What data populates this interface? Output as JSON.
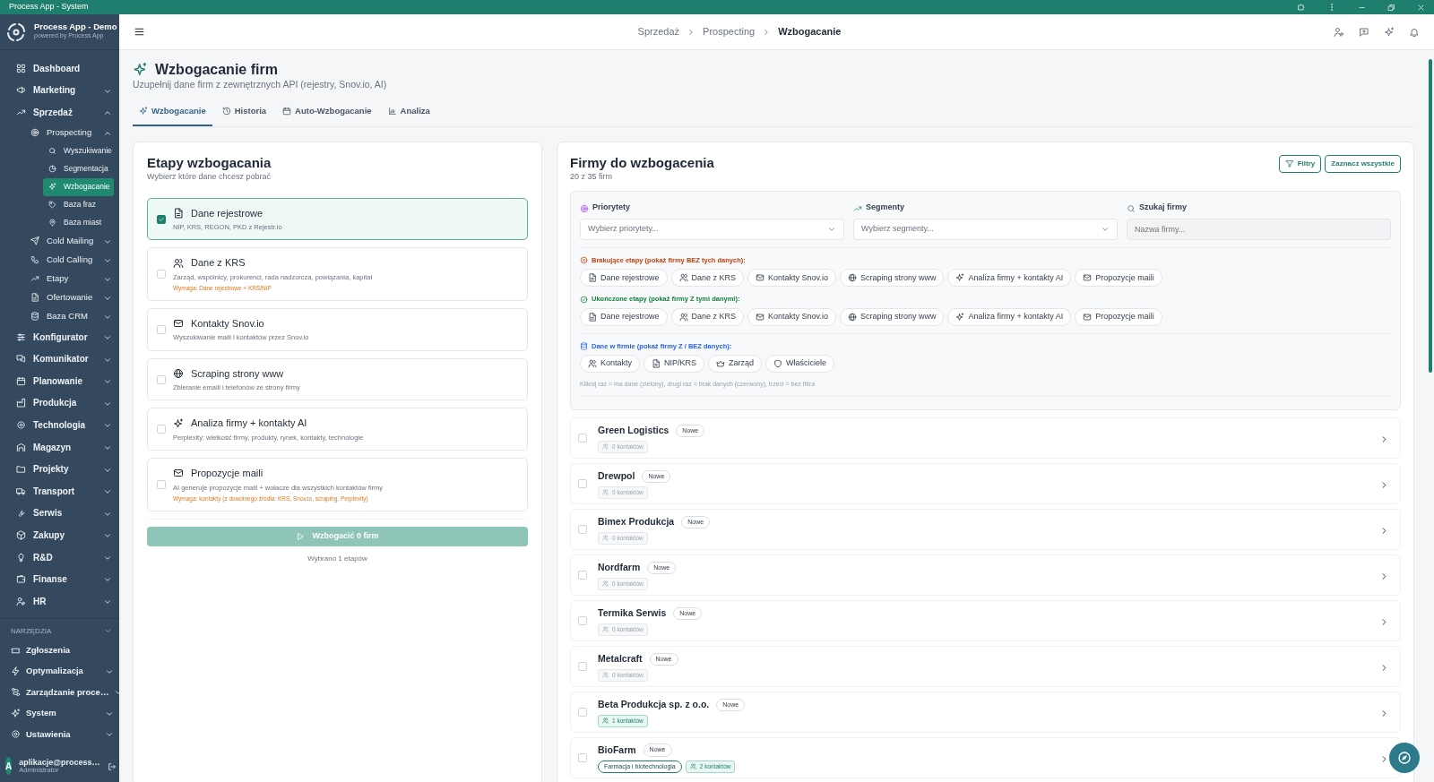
{
  "window": {
    "title": "Process App - System"
  },
  "sidebar": {
    "app_title": "Process App - Demo",
    "app_subtitle": "powered by Process App",
    "items": [
      {
        "label": "Dashboard",
        "selected": false
      },
      {
        "label": "Marketing",
        "selected": false,
        "expanded": false
      },
      {
        "label": "Sprzedaż",
        "selected": false,
        "expanded": true,
        "children": [
          {
            "label": "Prospecting",
            "selected": false,
            "expanded": true,
            "children": [
              {
                "label": "Wyszukiwanie",
                "selected": false
              },
              {
                "label": "Segmentacja",
                "selected": false
              },
              {
                "label": "Wzbogacanie",
                "selected": true
              },
              {
                "label": "Baza fraz",
                "selected": false
              },
              {
                "label": "Baza miast",
                "selected": false
              }
            ]
          },
          {
            "label": "Cold Mailing",
            "selected": false,
            "expanded": false
          },
          {
            "label": "Cold Calling",
            "selected": false,
            "expanded": false
          },
          {
            "label": "Etapy",
            "selected": false,
            "expanded": false
          },
          {
            "label": "Ofertowanie",
            "selected": false,
            "expanded": false
          },
          {
            "label": "Baza CRM",
            "selected": false,
            "expanded": false
          }
        ]
      },
      {
        "label": "Konfigurator",
        "selected": false,
        "expanded": false
      },
      {
        "label": "Komunikator",
        "selected": false,
        "expanded": false
      },
      {
        "label": "Planowanie",
        "selected": false,
        "expanded": false
      },
      {
        "label": "Produkcja",
        "selected": false,
        "expanded": false
      },
      {
        "label": "Technologia",
        "selected": false,
        "expanded": false
      },
      {
        "label": "Magazyn",
        "selected": false,
        "expanded": false
      },
      {
        "label": "Projekty",
        "selected": false,
        "expanded": false
      },
      {
        "label": "Transport",
        "selected": false,
        "expanded": false
      },
      {
        "label": "Serwis",
        "selected": false,
        "expanded": false
      },
      {
        "label": "Zakupy",
        "selected": false,
        "expanded": false
      },
      {
        "label": "R&D",
        "selected": false,
        "expanded": false
      },
      {
        "label": "Finanse",
        "selected": false,
        "expanded": false
      },
      {
        "label": "HR",
        "selected": false,
        "expanded": false
      }
    ],
    "section": "NARZĘDZIA",
    "tools": [
      {
        "label": "Zgłoszenia",
        "selected": false
      },
      {
        "label": "Optymalizacja",
        "selected": false,
        "expanded": false
      },
      {
        "label": "Zarządzanie proce…",
        "selected": false,
        "expanded": false
      },
      {
        "label": "System",
        "selected": false,
        "expanded": false
      },
      {
        "label": "Ustawienia",
        "selected": false,
        "expanded": false
      }
    ],
    "user": {
      "avatar": "A",
      "name": "aplikacje@process…",
      "role": "Administrator"
    }
  },
  "breadcrumbs": [
    "Sprzedaż",
    "Prospecting",
    "Wzbogacanie"
  ],
  "page": {
    "title": "Wzbogacanie firm",
    "subtitle": "Uzupełnij dane firm z zewnętrznych API (rejestry, Snov.io, AI)"
  },
  "tabs": [
    {
      "label": "Wzbogacanie",
      "selected": true
    },
    {
      "label": "Historia",
      "selected": false
    },
    {
      "label": "Auto-Wzbogacanie",
      "selected": false
    },
    {
      "label": "Analiza",
      "selected": false
    }
  ],
  "stages_card": {
    "title": "Etapy wzbogacania",
    "subtitle": "Wybierz które dane chcesz pobrać",
    "stages": [
      {
        "title": "Dane rejestrowe",
        "description": "NIP, KRS, REGON, PKD z Rejestr.io",
        "checked": true
      },
      {
        "title": "Dane z KRS",
        "description": "Zarząd, wspólnicy, prokurenci, rada nadzorcza, powiązania, kapitał",
        "requirement": "Wymaga: Dane rejestrowe + KRS/NIP",
        "checked": false
      },
      {
        "title": "Kontakty Snov.io",
        "description": "Wyszukiwanie maili i kontaktów przez Snov.io",
        "checked": false
      },
      {
        "title": "Scraping strony www",
        "description": "Zbieranie emaili i telefonów ze strony firmy",
        "checked": false
      },
      {
        "title": "Analiza firmy + kontakty AI",
        "description": "Perplexity: wielkość firmy, produkty, rynek, kontakty, technologie",
        "checked": false
      },
      {
        "title": "Propozycje maili",
        "description": "AI generuje propozycje maili + wołacze dla wszystkich kontaktów firmy",
        "requirement": "Wymaga: kontakty (z dowolnego źródła: KRS, Snov.io, scraping, Perplexity)",
        "checked": false
      }
    ],
    "button": {
      "label": "Wzbogacić 0 firm",
      "disabled": true
    },
    "footnote": "Wybrano 1 etapów"
  },
  "companies_card": {
    "title": "Firmy do wzbogacenia",
    "count": "20 z 35 firm",
    "buttons": [
      "Filtry",
      "Zaznacz wszystkie"
    ],
    "filters": {
      "priority": {
        "label": "Priorytety",
        "placeholder": "Wybierz priorytety..."
      },
      "segments": {
        "label": "Segmenty",
        "placeholder": "Wybierz segmenty..."
      },
      "search": {
        "label": "Szukaj firmy",
        "placeholder": "Nazwa firmy..."
      },
      "missing": {
        "label": "Brakujące etapy (pokaż firmy BEZ tych danych):",
        "chips": [
          {
            "label": "Dane rejestrowe",
            "selected": false
          },
          {
            "label": "Dane z KRS",
            "selected": false
          },
          {
            "label": "Kontakty Snov.io",
            "selected": false
          },
          {
            "label": "Scraping strony www",
            "selected": false
          },
          {
            "label": "Analiza firmy + kontakty AI",
            "selected": false
          },
          {
            "label": "Propozycje maili",
            "selected": false
          }
        ]
      },
      "completed": {
        "label": "Ukończone etapy (pokaż firmy Z tymi danymi):",
        "chips": [
          {
            "label": "Dane rejestrowe",
            "selected": false
          },
          {
            "label": "Dane z KRS",
            "selected": false
          },
          {
            "label": "Kontakty Snov.io",
            "selected": false
          },
          {
            "label": "Scraping strony www",
            "selected": false
          },
          {
            "label": "Analiza firmy + kontakty AI",
            "selected": false
          },
          {
            "label": "Propozycje maili",
            "selected": false
          }
        ]
      },
      "company_data": {
        "label": "Dane w firmie (pokaż firmy Z / BEZ danych):",
        "chips": [
          {
            "label": "Kontakty",
            "selected": false
          },
          {
            "label": "NIP/KRS",
            "selected": false
          },
          {
            "label": "Zarząd",
            "selected": false
          },
          {
            "label": "Właściciele",
            "selected": false
          }
        ],
        "hint": "Kliknij raz = ma dane (zielony), drugi raz = brak danych (czerwony), trzeci = bez filtra"
      }
    },
    "companies": [
      {
        "name": "Green Logistics",
        "status": "Nowe",
        "contacts": "0 kontaktów",
        "has_contacts": false,
        "checked": false
      },
      {
        "name": "Drewpol",
        "status": "Nowe",
        "contacts": "0 kontaktów",
        "has_contacts": false,
        "checked": false
      },
      {
        "name": "Bimex Produkcja",
        "status": "Nowe",
        "contacts": "0 kontaktów",
        "has_contacts": false,
        "checked": false
      },
      {
        "name": "Nordfarm",
        "status": "Nowe",
        "contacts": "0 kontaktów",
        "has_contacts": false,
        "checked": false
      },
      {
        "name": "Termika Serwis",
        "status": "Nowe",
        "contacts": "0 kontaktów",
        "has_contacts": false,
        "checked": false
      },
      {
        "name": "Metalcraft",
        "status": "Nowe",
        "contacts": "0 kontaktów",
        "has_contacts": false,
        "checked": false
      },
      {
        "name": "Beta Produkcja sp. z o.o.",
        "status": "Nowe",
        "contacts": "1 kontaktów",
        "has_contacts": true,
        "checked": false
      },
      {
        "name": "BioFarm",
        "status": "Nowe",
        "segment": "Farmacja i biotechnologia",
        "contacts": "2 kontaktów",
        "has_contacts": true,
        "checked": false
      }
    ]
  }
}
